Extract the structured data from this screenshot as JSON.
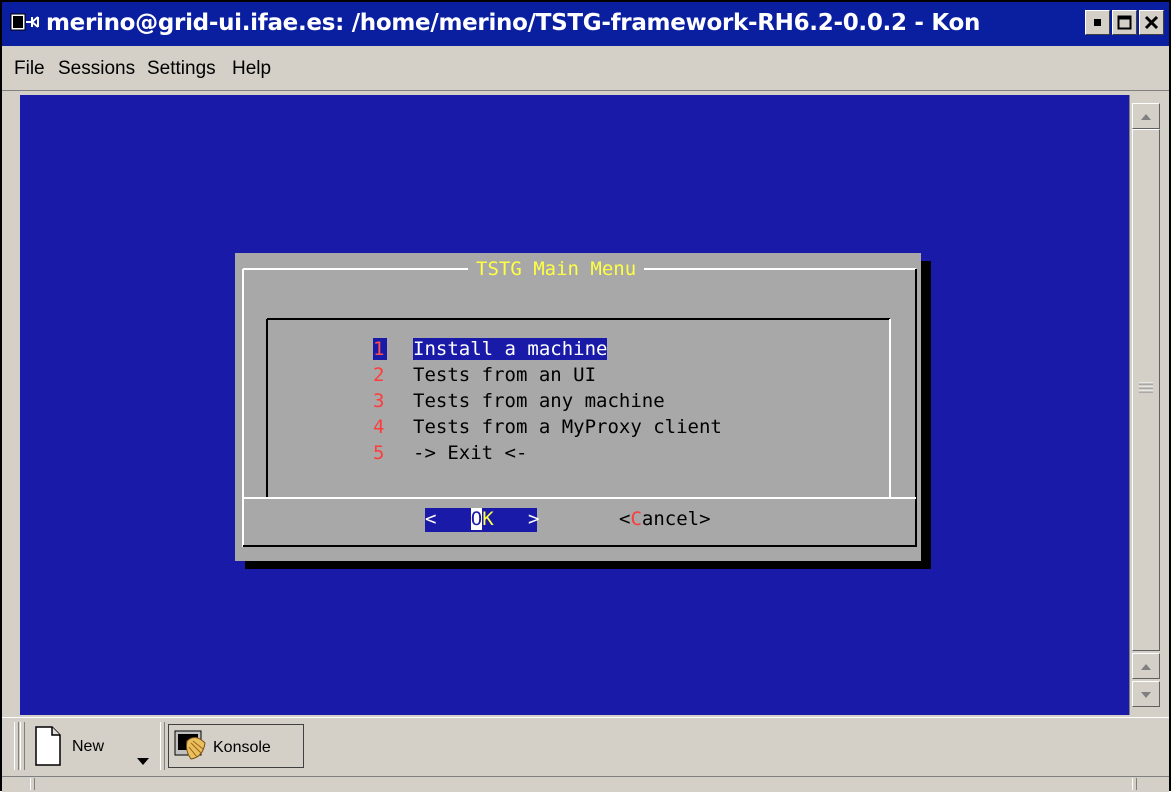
{
  "window": {
    "title": "merino@grid-ui.ifae.es: /home/merino/TSTG-framework-RH6.2-0.0.2 - Kon"
  },
  "menubar": {
    "items": [
      "File",
      "Sessions",
      "Settings",
      "Help"
    ]
  },
  "dialog": {
    "title": "TSTG Main Menu",
    "items": [
      {
        "num": "1",
        "label": "Install a machine",
        "selected": true
      },
      {
        "num": "2",
        "label": "Tests from an UI",
        "selected": false
      },
      {
        "num": "3",
        "label": "Tests from any machine",
        "selected": false
      },
      {
        "num": "4",
        "label": "Tests from a MyProxy client",
        "selected": false
      },
      {
        "num": "5",
        "label": "-> Exit <-",
        "selected": false
      }
    ],
    "ok_button": {
      "left": "<",
      "hot": "O",
      "rest": "K",
      "right": ">"
    },
    "cancel_button": {
      "open": "<",
      "hot": "C",
      "rest": "ancel",
      "close": ">"
    }
  },
  "taskbar": {
    "new_label": "New",
    "konsole_label": "Konsole"
  },
  "colors": {
    "terminal_bg": "#1a1aa8",
    "titlebar_bg": "#0a1ea0",
    "dialog_bg": "#a8a8a8",
    "dialog_title": "#ffff44",
    "hotkey": "#ff3c3c"
  }
}
